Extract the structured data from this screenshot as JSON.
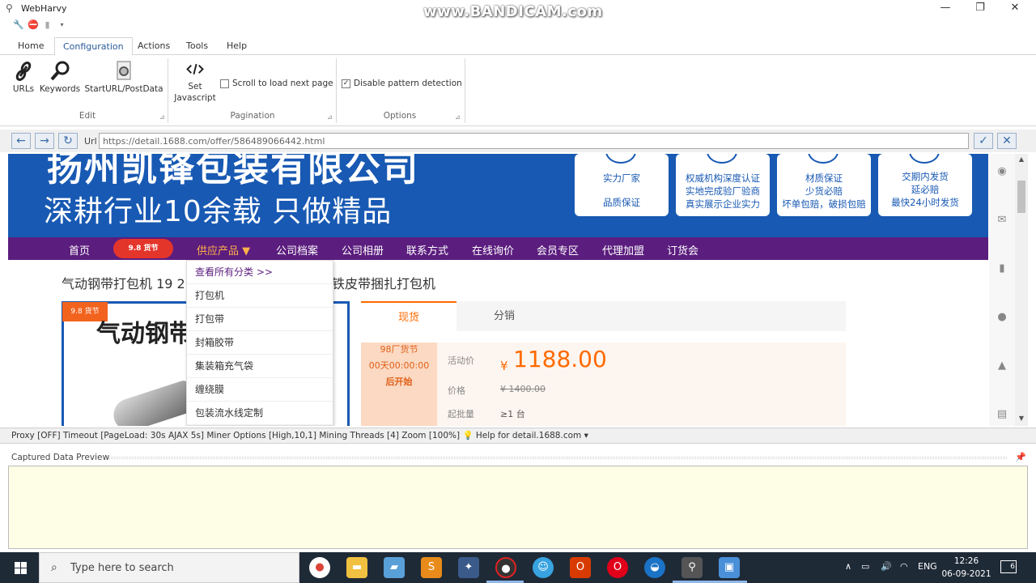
{
  "window": {
    "title": "WebHarvy",
    "watermark": "www.BANDICAM.com",
    "minimize": "—",
    "maximize": "❐",
    "close": "✕"
  },
  "ribbon_tabs": [
    "Home",
    "Configuration",
    "Actions",
    "Tools",
    "Help"
  ],
  "ribbon": {
    "edit_group": {
      "label": "Edit",
      "buttons": [
        "URLs",
        "Keywords",
        "StartURL/PostData"
      ]
    },
    "set_js": {
      "line1": "Set",
      "line2": "Javascript"
    },
    "pagination_group": {
      "label": "Pagination",
      "checkbox": "Scroll to load next page",
      "checked": false
    },
    "options_group": {
      "label": "Options",
      "checkbox": "Disable pattern detection",
      "checked": true
    }
  },
  "nav": {
    "url_label": "Url",
    "url_value": "https://detail.1688.com/offer/586489066442.html"
  },
  "page": {
    "banner_line1": "扬州凯锋包装有限公司",
    "banner_line2": "深耕行业10余载 只做精品",
    "cards": [
      {
        "l1": "实力厂家",
        "l2": "品质保证"
      },
      {
        "l1": "权威机构深度认证",
        "l2": "实地完成验厂验商",
        "l3": "真实展示企业实力"
      },
      {
        "l1": "材质保证",
        "l2": "少货必赔",
        "l3": "坏单包赔，破损包赔"
      },
      {
        "l1": "交期内发货",
        "l2": "延必赔",
        "l3": "最快24小时发货"
      }
    ],
    "menu": [
      "首页",
      "供应产品 ▼",
      "公司档案",
      "公司相册",
      "联系方式",
      "在线询价",
      "会员专区",
      "代理加盟",
      "订货会"
    ],
    "promo_badge": "9.8 货节",
    "title_left": "气动钢带打包机 19 2",
    "title_right": "铁皮带捆扎打包机",
    "image_text": "气动钢带",
    "image_badge": "9.8 货节",
    "dropdown": [
      "查看所有分类 >>",
      "打包机",
      "打包带",
      "封箱胶带",
      "集装箱充气袋",
      "缠绕膜",
      "包装流水线定制"
    ],
    "tabs": [
      "现货",
      "分销"
    ],
    "festival": "98厂货节",
    "countdown": "00天00:00:00",
    "countdown_note": "后开始",
    "labels": {
      "activity": "活动价",
      "price": "价格",
      "moq": "起批量"
    },
    "yen": "¥",
    "activity_price": "1188.00",
    "orig_price": "¥ 1400.00",
    "moq": "≥1 台"
  },
  "status_bar": {
    "text": "Proxy [OFF] Timeout [PageLoad: 30s AJAX 5s] Miner Options [High,10,1] Mining Threads [4] Zoom [100%]",
    "help": "Help for detail.1688.com ▾"
  },
  "preview": {
    "title": "Captured Data Preview"
  },
  "taskbar": {
    "search_placeholder": "Type here to search",
    "lang": "ENG",
    "time": "12:26",
    "date": "06-09-2021",
    "notifications": "6"
  }
}
